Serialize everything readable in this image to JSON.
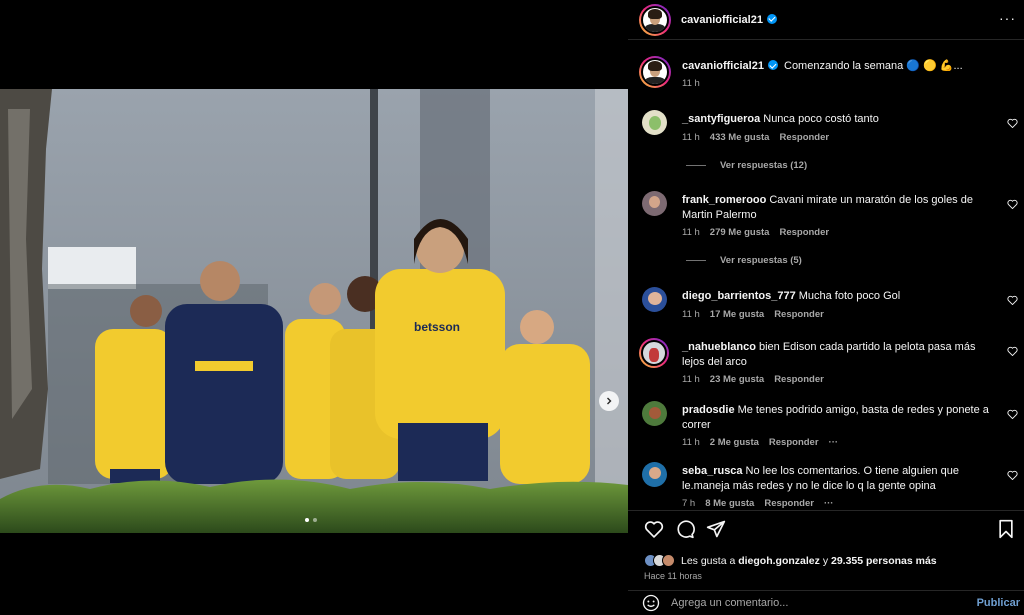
{
  "post": {
    "author": "cavaniofficial21",
    "caption": "Comenzando la semana 🔵 🟡 💪...",
    "caption_time": "11 h"
  },
  "photo": {
    "jersey_sponsor": "betsson"
  },
  "comments": [
    {
      "user": "_santyfigueroa",
      "text": "Nunca poco costó tanto",
      "time": "11 h",
      "likes": "433 Me gusta",
      "reply": "Responder",
      "view_replies": "Ver respuestas (12)"
    },
    {
      "user": "frank_romerooo",
      "text": "Cavani mirate un maratón de los goles de Martin Palermo",
      "time": "11 h",
      "likes": "279 Me gusta",
      "reply": "Responder",
      "view_replies": "Ver respuestas (5)"
    },
    {
      "user": "diego_barrientos_777",
      "text": "Mucha foto poco Gol",
      "time": "11 h",
      "likes": "17 Me gusta",
      "reply": "Responder"
    },
    {
      "user": "_nahueblanco",
      "text": "bien Edison cada partido la pelota pasa más lejos del arco",
      "time": "11 h",
      "likes": "23 Me gusta",
      "reply": "Responder"
    },
    {
      "user": "pradosdie",
      "text": "Me tenes podrido amigo, basta de redes y ponete a correr",
      "time": "11 h",
      "likes": "2 Me gusta",
      "reply": "Responder",
      "more": "···"
    },
    {
      "user": "seba_rusca",
      "text": "No lee los comentarios. O tiene alguien que le.maneja más redes y no le dice lo q la gente opina",
      "time": "7 h",
      "likes": "8 Me gusta",
      "reply": "Responder",
      "more": "···"
    }
  ],
  "likes": {
    "prefix": "Les gusta a",
    "user": "diegoh.gonzalez",
    "connector": "y",
    "others": "29.355 personas más"
  },
  "time_ago": "Hace 11 horas",
  "comment_box": {
    "placeholder": "Agrega un comentario...",
    "publish_label": "Publicar"
  },
  "header": {
    "more_icon": "···"
  },
  "colors": {
    "background": "#000000",
    "accent": "#0095f6",
    "muted": "#a8a8a8",
    "boca_yellow": "#f2cb2e",
    "boca_navy": "#1c2a56"
  }
}
